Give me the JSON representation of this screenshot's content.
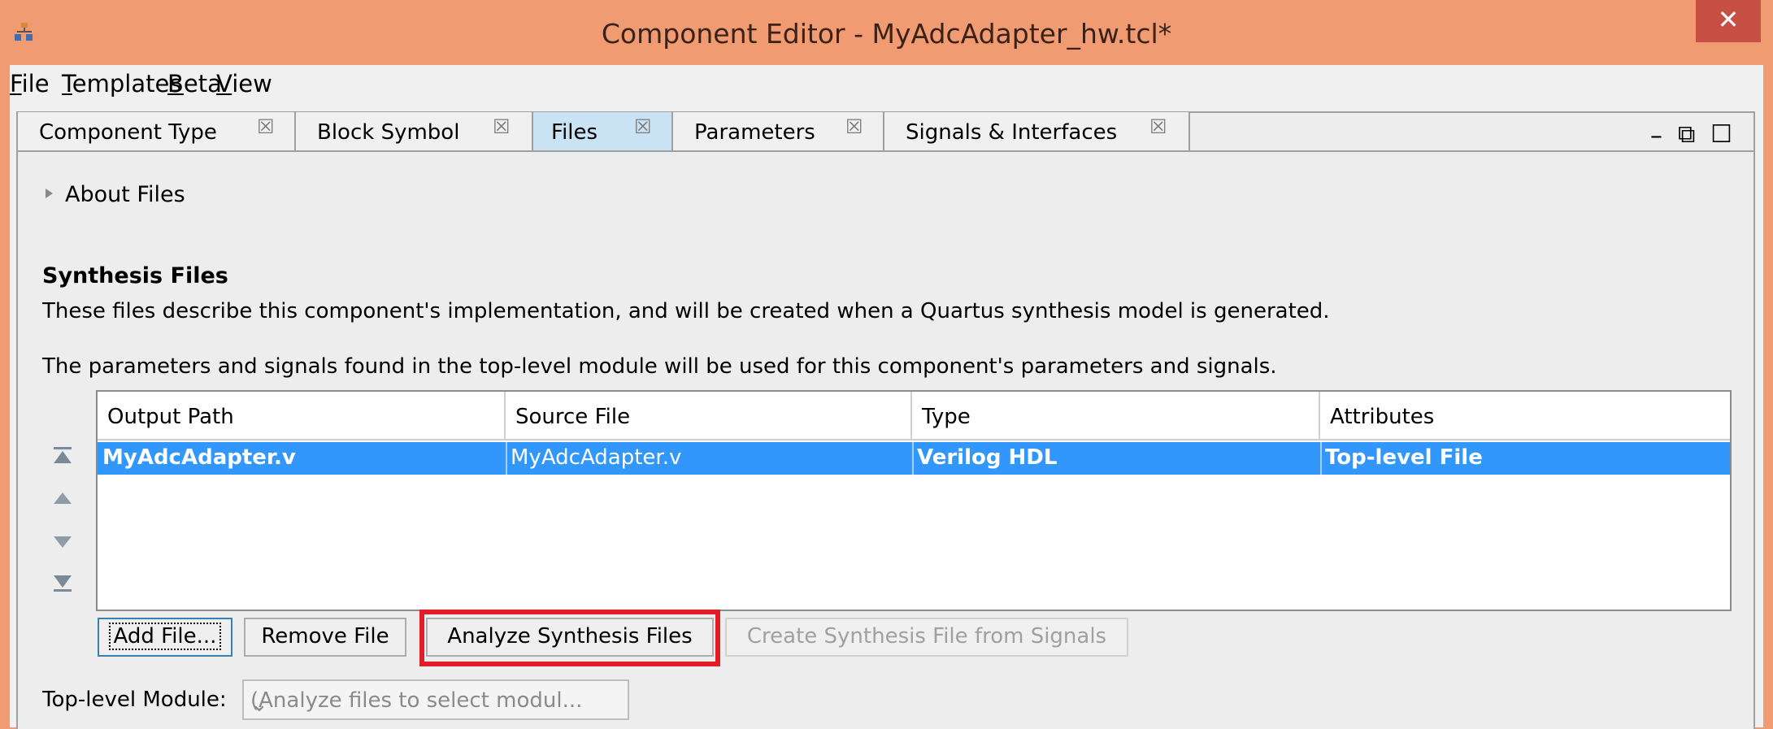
{
  "window": {
    "title": "Component Editor - MyAdcAdapter_hw.tcl*",
    "close_glyph": "✕"
  },
  "menu": [
    {
      "mn": "F",
      "rest": "ile"
    },
    {
      "mn": "T",
      "rest": "emplates"
    },
    {
      "mn": "B",
      "rest": "eta"
    },
    {
      "mn": "V",
      "rest": "iew"
    }
  ],
  "tabs": [
    {
      "label": "Component Type",
      "close": "☒"
    },
    {
      "label": "Block Symbol",
      "close": "☒"
    },
    {
      "label": "Files",
      "close": "☒",
      "active": true
    },
    {
      "label": "Parameters",
      "close": "☒"
    },
    {
      "label": "Signals & Interfaces",
      "close": "☒"
    }
  ],
  "window_controls": {
    "minimize": "–",
    "detach": "⧉",
    "maximize": "☐"
  },
  "about": {
    "label": "About Files"
  },
  "synthesis": {
    "title": "Synthesis Files",
    "desc1": "These files describe this component's implementation, and will be created when a Quartus synthesis model is generated.",
    "desc2": "The parameters and signals found in the top-level module will be used for this component's parameters and signals."
  },
  "table": {
    "columns": [
      "Output Path",
      "Source File",
      "Type",
      "Attributes"
    ],
    "rows": [
      {
        "output_path": "MyAdcAdapter.v",
        "source_file": "MyAdcAdapter.v",
        "type": "Verilog HDL",
        "attributes": "Top-level File",
        "selected": true
      }
    ]
  },
  "buttons": {
    "add_file": "Add File...",
    "remove_file": "Remove File",
    "analyze": "Analyze Synthesis Files",
    "create_from_signals": "Create Synthesis File from Signals"
  },
  "top_level": {
    "label": "Top-level Module:",
    "placeholder": "(Analyze files to select modul...",
    "chevron": "⌄"
  },
  "colors": {
    "titlebar": "#f19b72",
    "close": "#c74f44",
    "selection": "#3297fd",
    "active_tab": "#c9e3f5",
    "highlight": "#e01d28"
  }
}
